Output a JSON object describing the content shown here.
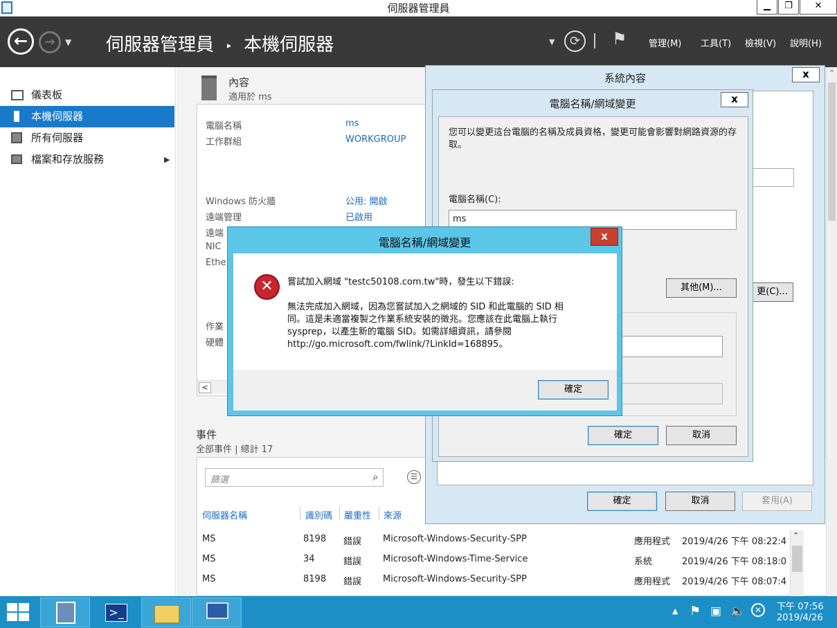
{
  "window": {
    "title": "伺服器管理員"
  },
  "toolbar": {
    "breadcrumb_root": "伺服器管理員",
    "breadcrumb_sep": "‣",
    "breadcrumb_current": "本機伺服器",
    "menus": [
      "管理(M)",
      "工具(T)",
      "檢視(V)",
      "說明(H)"
    ]
  },
  "sidebar": {
    "items": [
      {
        "label": "儀表板"
      },
      {
        "label": "本機伺服器"
      },
      {
        "label": "所有伺服器"
      },
      {
        "label": "檔案和存放服務"
      }
    ]
  },
  "properties": {
    "title": "內容",
    "subtitle": "適用於 ms",
    "rows": [
      {
        "label": "電腦名稱",
        "value": "ms"
      },
      {
        "label": "工作群組",
        "value": "WORKGROUP"
      },
      {
        "label": "Windows 防火牆",
        "value": "公用: 開啟"
      },
      {
        "label": "遠端管理",
        "value": "已啟用"
      }
    ],
    "truncated_labels": [
      "遠端",
      "NIC",
      "Ethe",
      "作業",
      "硬體"
    ],
    "scroll_left": "<"
  },
  "events": {
    "title": "事件",
    "subtitle": "全部事件 | 總計 17",
    "filter_placeholder": "篩選",
    "columns": [
      "伺服器名稱",
      "識別碼",
      "嚴重性",
      "來源"
    ],
    "rows": [
      {
        "server": "MS",
        "id": "8198",
        "severity": "錯誤",
        "source": "Microsoft-Windows-Security-SPP",
        "log": "應用程式",
        "time": "2019/4/26 下午 08:22:4"
      },
      {
        "server": "MS",
        "id": "34",
        "severity": "錯誤",
        "source": "Microsoft-Windows-Time-Service",
        "log": "系統",
        "time": "2019/4/26 下午 08:18:0"
      },
      {
        "server": "MS",
        "id": "8198",
        "severity": "錯誤",
        "source": "Microsoft-Windows-Security-SPP",
        "log": "應用程式",
        "time": "2019/4/26 下午 08:07:4"
      }
    ]
  },
  "system_props": {
    "title": "系統內容",
    "close": "x",
    "ok": "確定",
    "cancel": "取消",
    "apply": "套用(A)",
    "change_partial": "更(C)..."
  },
  "rename_dialog": {
    "title": "電腦名稱/網域變更",
    "close": "x",
    "description": "您可以變更這台電腦的名稱及成員資格，變更可能會影響對網路資源的存取。",
    "name_label": "電腦名稱(C):",
    "name_value": "ms",
    "more": "其他(M)...",
    "ok": "確定",
    "cancel": "取消"
  },
  "error_dialog": {
    "title": "電腦名稱/網域變更",
    "close": "x",
    "heading": "嘗試加入網域 \"testc50108.com.tw\"時，發生以下錯誤:",
    "message_line1": "無法完成加入網域，因為您嘗試加入之網域的 SID 和此電腦的 SID 相",
    "message_line2": "同。這是未適當複製之作業系統安裝的徵兆。您應該在此電腦上執行",
    "message_line3": "sysprep，以產生新的電腦 SID。如需詳細資訊，請參閱",
    "message_line4": "http://go.microsoft.com/fwlink/?LinkId=168895。",
    "ok": "確定"
  },
  "taskbar": {
    "time": "下午 07:56",
    "date": "2019/4/26"
  },
  "colors": {
    "toolbar": "#393939",
    "accent": "#1979ca",
    "taskbar": "#1d8fc7",
    "error_title": "#5bc6e8",
    "error_close": "#c7402f"
  }
}
